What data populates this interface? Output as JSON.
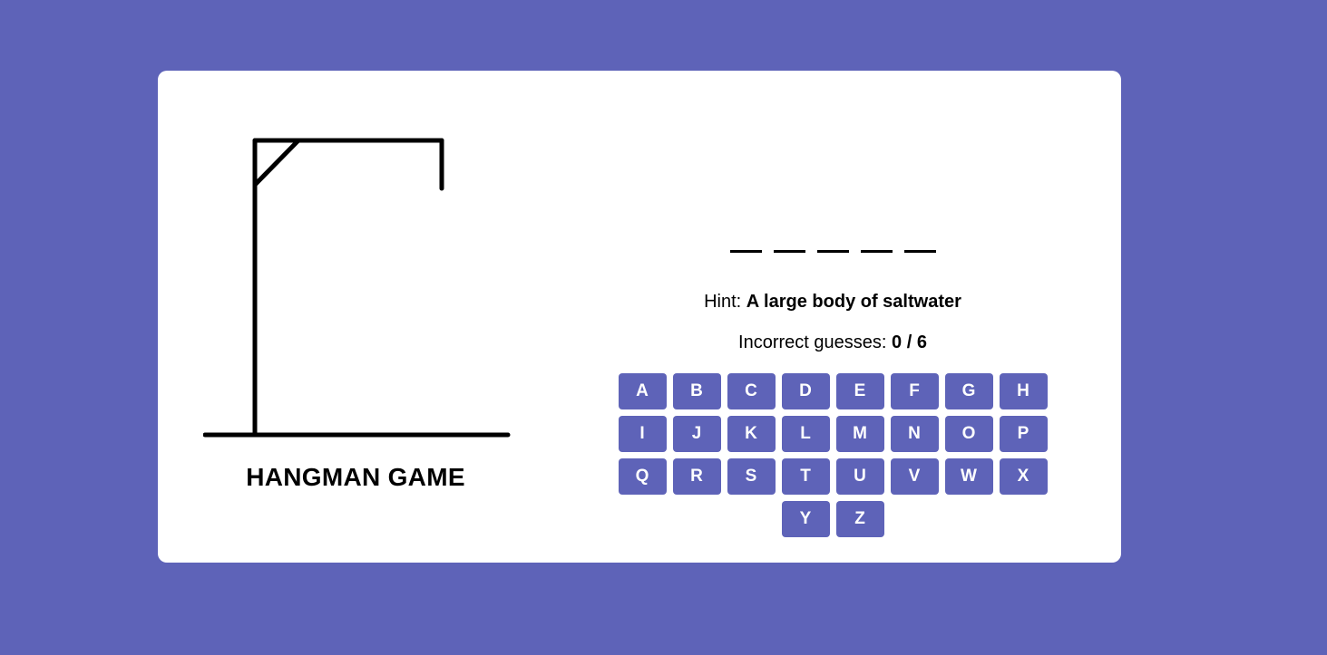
{
  "title": "HANGMAN GAME",
  "word": {
    "slots": [
      "",
      "",
      "",
      "",
      ""
    ]
  },
  "hint": {
    "label": "Hint:",
    "text": "A large body of saltwater"
  },
  "guesses": {
    "label": "Incorrect guesses:",
    "value": "0 / 6"
  },
  "keyboard": {
    "keys": [
      "A",
      "B",
      "C",
      "D",
      "E",
      "F",
      "G",
      "H",
      "I",
      "J",
      "K",
      "L",
      "M",
      "N",
      "O",
      "P",
      "Q",
      "R",
      "S",
      "T",
      "U",
      "V",
      "W",
      "X",
      "Y",
      "Z"
    ]
  },
  "colors": {
    "background": "#5e63b8",
    "card": "#ffffff",
    "key": "#5e63b8",
    "key_text": "#ffffff"
  },
  "icons": {
    "gallows": "gallows-icon"
  }
}
